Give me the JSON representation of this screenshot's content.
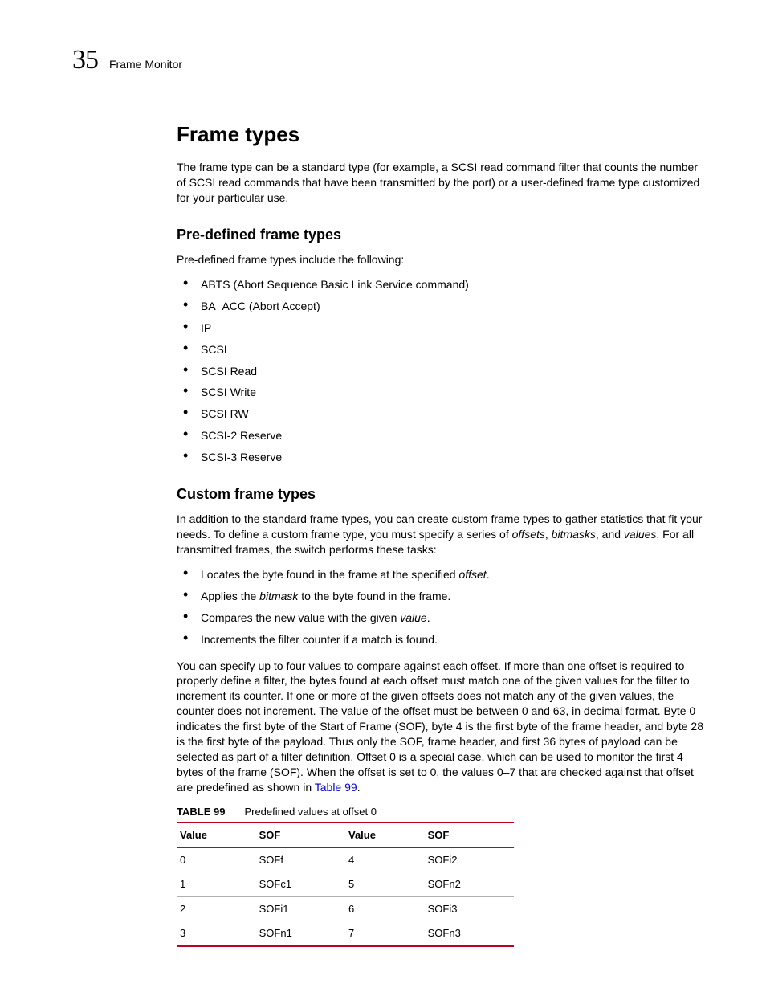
{
  "header": {
    "chapter_number": "35",
    "running_title": "Frame Monitor"
  },
  "section_title": "Frame types",
  "intro_paragraph": "The frame type can be a standard type (for example, a SCSI read command filter that counts the number of SCSI read commands that have been transmitted by the port) or a user-defined frame type customized for your particular use.",
  "predefined": {
    "heading": "Pre-defined frame types",
    "lead": "Pre-defined frame types include the following:",
    "items": [
      "ABTS (Abort Sequence Basic Link Service command)",
      "BA_ACC (Abort Accept)",
      "IP",
      "SCSI",
      "SCSI Read",
      "SCSI Write",
      "SCSI RW",
      "SCSI-2 Reserve",
      "SCSI-3 Reserve"
    ]
  },
  "custom": {
    "heading": "Custom frame types",
    "p1_a": "In addition to the standard frame types, you can create custom frame types to gather statistics that fit your needs. To define a custom frame type, you must specify a series of ",
    "p1_offsets": "offsets",
    "p1_b": ", ",
    "p1_bitmasks": "bitmasks",
    "p1_c": ", and ",
    "p1_values": "values",
    "p1_d": ". For all transmitted frames, the switch performs these tasks:",
    "tasks": {
      "t1a": "Locates the byte found in the frame at the specified ",
      "t1b": "offset",
      "t1c": ".",
      "t2a": "Applies the ",
      "t2b": "bitmask",
      "t2c": " to the byte found in the frame.",
      "t3a": "Compares the new value with the given ",
      "t3b": "value",
      "t3c": ".",
      "t4": "Increments the filter counter if a match is found."
    },
    "p2_a": "You can specify up to four values to compare against each offset. If more than one offset is required to properly define a filter, the bytes found at each offset must match one of the given values for the filter to increment its counter. If one or more of the given offsets does not match any of the given values, the counter does not increment. The value of the offset must be between 0 and 63, in decimal format. Byte 0 indicates the first byte of the Start of Frame (SOF), byte 4 is the first byte of the frame header, and byte 28 is the first byte of the payload. Thus only the SOF, frame header, and first 36 bytes of payload can be selected as part of a filter definition. Offset 0 is a special case, which can be used to monitor the first 4 bytes of the frame (SOF). When the offset is set to 0, the values 0–7 that are checked against that offset are predefined as shown in ",
    "p2_link": "Table 99",
    "p2_b": "."
  },
  "table99": {
    "label": "TABLE 99",
    "caption": "Predefined values at offset 0",
    "headers": [
      "Value",
      "SOF",
      "Value",
      "SOF"
    ],
    "rows": [
      [
        "0",
        "SOFf",
        "4",
        "SOFi2"
      ],
      [
        "1",
        "SOFc1",
        "5",
        "SOFn2"
      ],
      [
        "2",
        "SOFi1",
        "6",
        "SOFi3"
      ],
      [
        "3",
        "SOFn1",
        "7",
        "SOFn3"
      ]
    ]
  },
  "chart_data": {
    "type": "table",
    "title": "Predefined values at offset 0",
    "columns": [
      "Value",
      "SOF"
    ],
    "rows": [
      {
        "Value": 0,
        "SOF": "SOFf"
      },
      {
        "Value": 1,
        "SOF": "SOFc1"
      },
      {
        "Value": 2,
        "SOF": "SOFi1"
      },
      {
        "Value": 3,
        "SOF": "SOFn1"
      },
      {
        "Value": 4,
        "SOF": "SOFi2"
      },
      {
        "Value": 5,
        "SOF": "SOFn2"
      },
      {
        "Value": 6,
        "SOF": "SOFi3"
      },
      {
        "Value": 7,
        "SOF": "SOFn3"
      }
    ]
  }
}
